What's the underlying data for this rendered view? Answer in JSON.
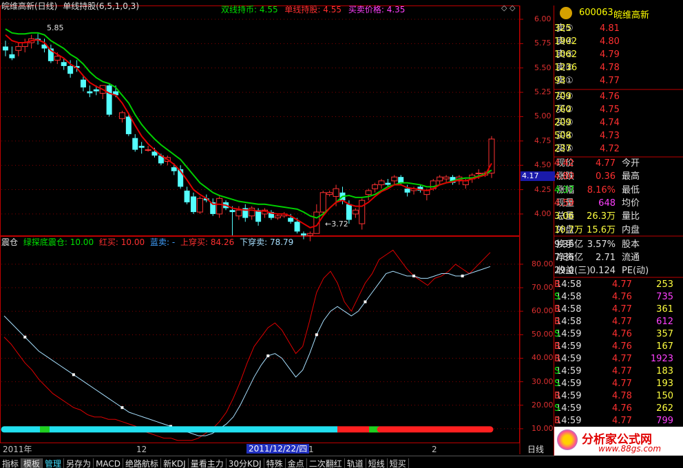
{
  "header": {
    "title": "皖维高新(日线)",
    "formula": "单线持股(6,5,1,0,3)",
    "double_hold_label": "双线持币:",
    "double_hold_value": "4.55",
    "single_hold_label": "单线持股:",
    "single_hold_value": "4.55",
    "trade_price_label": "买卖价格:",
    "trade_price_value": "4.35",
    "max_label": "5.85",
    "min_label": "3.72",
    "current_price_tag": "4.17"
  },
  "lower_header": {
    "name": "震仓",
    "green_bottom_label": "绿探底震仓:",
    "green_bottom_value": "10.00",
    "red_buy_label": "红买:",
    "red_buy_value": "10.00",
    "blue_sell_label": "蓝卖:",
    "blue_sell_value": "-",
    "upcross_label": "上穿买:",
    "upcross_value": "84.26",
    "downcross_label": "下穿卖:",
    "downcross_value": "78.79"
  },
  "upper_axis": [
    "6.00",
    "5.75",
    "5.50",
    "5.25",
    "5.00",
    "4.75",
    "4.50",
    "4.25",
    "4.00"
  ],
  "lower_axis": [
    "80.00",
    "70.00",
    "60.00",
    "50.00",
    "40.00",
    "30.00",
    "20.00",
    "10.00"
  ],
  "date_axis": {
    "year": "2011年",
    "m12": "12",
    "cursor_date": "2011/12/22/四",
    "m1": "1",
    "m2": "2",
    "period": "日线"
  },
  "stock": {
    "code": "600063",
    "name": "皖维高新"
  },
  "order_book": {
    "asks": [
      {
        "label": "卖⑤",
        "price": "4.81",
        "vol": "325"
      },
      {
        "label": "卖④",
        "price": "4.80",
        "vol": "1902"
      },
      {
        "label": "卖③",
        "price": "4.79",
        "vol": "1062"
      },
      {
        "label": "卖②",
        "price": "4.78",
        "vol": "1236"
      },
      {
        "label": "卖①",
        "price": "4.77",
        "vol": "93"
      }
    ],
    "bids": [
      {
        "label": "买①",
        "price": "4.76",
        "vol": "709"
      },
      {
        "label": "买②",
        "price": "4.75",
        "vol": "760"
      },
      {
        "label": "买③",
        "price": "4.74",
        "vol": "209"
      },
      {
        "label": "买④",
        "price": "4.73",
        "vol": "508"
      },
      {
        "label": "买⑤",
        "price": "4.72",
        "vol": "237"
      }
    ]
  },
  "quote": [
    {
      "l1": "现价",
      "v1": "4.77",
      "l2": "今开",
      "v2": "4.42"
    },
    {
      "l1": "涨跌",
      "v1": "0.36",
      "l2": "最高",
      "v2": "4.80"
    },
    {
      "l1": "涨幅",
      "v1": "8.16%",
      "l2": "最低",
      "v2": "4.37"
    },
    {
      "l1": "现量",
      "v1": "648",
      "l2": "均价",
      "v2": "4.59"
    },
    {
      "l1": "总量",
      "v1": "26.3万",
      "l2": "量比",
      "v2": "3.06"
    },
    {
      "l1": "外盘",
      "v1": "15.6万",
      "l2": "内盘",
      "v2": "10.7万"
    },
    {
      "l1": "换手",
      "v1": "3.57%",
      "l2": "股本",
      "v2": "9.36亿"
    },
    {
      "l1": "净资",
      "v1": "2.71",
      "l2": "流通",
      "v2": "7.36亿"
    },
    {
      "l1": "收益(三)",
      "v1": "0.124",
      "l2": "PE(动)",
      "v2": "29.0"
    }
  ],
  "ticks": [
    {
      "t": "14:58",
      "p": "4.77",
      "v": "253",
      "s": "B"
    },
    {
      "t": "14:58",
      "p": "4.76",
      "v": "735",
      "s": "S"
    },
    {
      "t": "14:58",
      "p": "4.77",
      "v": "361",
      "s": "B"
    },
    {
      "t": "14:58",
      "p": "4.77",
      "v": "612",
      "s": "B"
    },
    {
      "t": "14:59",
      "p": "4.76",
      "v": "357",
      "s": "S"
    },
    {
      "t": "14:59",
      "p": "4.76",
      "v": "167",
      "s": "B"
    },
    {
      "t": "14:59",
      "p": "4.77",
      "v": "1923",
      "s": "B"
    },
    {
      "t": "14:59",
      "p": "4.77",
      "v": "183",
      "s": "S"
    },
    {
      "t": "14:59",
      "p": "4.77",
      "v": "193",
      "s": "S"
    },
    {
      "t": "14:59",
      "p": "4.78",
      "v": "150",
      "s": "B"
    },
    {
      "t": "14:59",
      "p": "4.76",
      "v": "262",
      "s": "S"
    },
    {
      "t": "14:59",
      "p": "4.77",
      "v": "799",
      "s": "B"
    }
  ],
  "watermark": {
    "brand": "分析家公式网",
    "url": "www.88gs.com"
  },
  "bottom_tabs": [
    "指标",
    "模板",
    "管理",
    "另存为",
    "MACD",
    "绝路航标",
    "新KDJ",
    "量看主力",
    "30分KDJ",
    "特殊",
    "金点",
    "二次翻红",
    "轨道",
    "短线",
    "短买"
  ],
  "colors": {
    "up": "#ff3232",
    "down": "#54ffff",
    "green_line": "#00d000",
    "red_line": "#e00000",
    "white_line": "#a8e0ff",
    "axis": "#c00000"
  },
  "chart_data": [
    {
      "type": "candlestick",
      "title": "皖维高新(日线)",
      "ylim": [
        3.62,
        6.02
      ],
      "candles": [
        [
          5.72,
          5.78,
          5.62,
          5.68
        ],
        [
          5.64,
          5.72,
          5.58,
          5.6
        ],
        [
          5.68,
          5.76,
          5.62,
          5.72
        ],
        [
          5.72,
          5.8,
          5.66,
          5.76
        ],
        [
          5.76,
          5.84,
          5.7,
          5.8
        ],
        [
          5.8,
          5.85,
          5.74,
          5.78
        ],
        [
          5.74,
          5.8,
          5.66,
          5.7
        ],
        [
          5.7,
          5.74,
          5.55,
          5.57
        ],
        [
          5.58,
          5.66,
          5.54,
          5.62
        ],
        [
          5.56,
          5.6,
          5.48,
          5.52
        ],
        [
          5.52,
          5.58,
          5.4,
          5.44
        ],
        [
          5.52,
          5.58,
          5.46,
          5.5
        ],
        [
          5.38,
          5.42,
          5.26,
          5.3
        ],
        [
          5.26,
          5.32,
          5.2,
          5.24
        ],
        [
          5.28,
          5.32,
          5.22,
          5.26
        ],
        [
          5.24,
          5.32,
          5.18,
          5.32
        ],
        [
          5.32,
          5.34,
          5.0,
          5.02
        ],
        [
          5.26,
          5.32,
          5.2,
          5.22
        ],
        [
          4.98,
          5.06,
          4.94,
          5.04
        ],
        [
          5.0,
          5.04,
          4.8,
          4.82
        ],
        [
          4.78,
          4.82,
          4.64,
          4.66
        ],
        [
          4.7,
          4.74,
          4.62,
          4.68
        ],
        [
          4.66,
          4.7,
          4.64,
          4.66
        ],
        [
          4.64,
          4.68,
          4.58,
          4.6
        ],
        [
          4.6,
          4.62,
          4.5,
          4.52
        ],
        [
          4.54,
          4.6,
          4.5,
          4.58
        ],
        [
          4.48,
          4.52,
          4.4,
          4.44
        ],
        [
          4.46,
          4.5,
          4.26,
          4.28
        ],
        [
          4.24,
          4.28,
          4.1,
          4.12
        ],
        [
          4.18,
          4.22,
          4.0,
          4.02
        ],
        [
          4.02,
          4.18,
          4.0,
          4.16
        ],
        [
          4.16,
          4.2,
          4.12,
          4.14
        ],
        [
          4.12,
          4.16,
          3.98,
          4.0
        ],
        [
          4.0,
          4.18,
          3.96,
          4.16
        ],
        [
          4.12,
          4.14,
          4.04,
          4.06
        ],
        [
          4.04,
          4.08,
          3.78,
          4.02
        ],
        [
          3.98,
          4.08,
          3.94,
          4.04
        ],
        [
          4.06,
          4.1,
          3.92,
          3.96
        ],
        [
          3.98,
          4.08,
          3.94,
          4.06
        ],
        [
          4.04,
          4.06,
          3.88,
          3.92
        ],
        [
          4.0,
          4.06,
          3.96,
          4.04
        ],
        [
          4.02,
          4.04,
          3.94,
          3.96
        ],
        [
          3.96,
          4.0,
          3.94,
          3.98
        ],
        [
          3.98,
          4.02,
          3.96,
          4.0
        ],
        [
          3.96,
          4.0,
          3.9,
          3.92
        ],
        [
          3.92,
          3.96,
          3.8,
          3.82
        ],
        [
          3.8,
          3.82,
          3.74,
          3.78
        ],
        [
          3.78,
          3.82,
          3.72,
          3.8
        ],
        [
          3.8,
          4.1,
          3.8,
          4.02
        ],
        [
          4.02,
          4.24,
          4.0,
          4.22
        ],
        [
          4.2,
          4.24,
          4.18,
          4.22
        ],
        [
          4.18,
          4.3,
          4.08,
          4.26
        ],
        [
          4.22,
          4.28,
          4.1,
          4.14
        ],
        [
          4.1,
          4.14,
          3.9,
          3.94
        ],
        [
          4.0,
          4.06,
          3.96,
          4.04
        ],
        [
          3.9,
          4.16,
          3.84,
          4.14
        ],
        [
          4.2,
          4.26,
          4.14,
          4.24
        ],
        [
          4.26,
          4.32,
          4.22,
          4.3
        ],
        [
          4.3,
          4.36,
          4.26,
          4.34
        ],
        [
          4.32,
          4.36,
          4.28,
          4.3
        ],
        [
          4.34,
          4.4,
          4.3,
          4.38
        ],
        [
          4.38,
          4.4,
          4.3,
          4.32
        ],
        [
          4.26,
          4.3,
          4.18,
          4.22
        ],
        [
          4.24,
          4.28,
          4.2,
          4.26
        ],
        [
          4.28,
          4.3,
          4.22,
          4.24
        ],
        [
          4.2,
          4.26,
          4.14,
          4.24
        ],
        [
          4.26,
          4.36,
          4.24,
          4.34
        ],
        [
          4.34,
          4.4,
          4.3,
          4.38
        ],
        [
          4.36,
          4.4,
          4.32,
          4.38
        ],
        [
          4.38,
          4.4,
          4.3,
          4.32
        ],
        [
          4.34,
          4.4,
          4.3,
          4.38
        ],
        [
          4.3,
          4.36,
          4.26,
          4.34
        ],
        [
          4.36,
          4.42,
          4.32,
          4.4
        ],
        [
          4.42,
          4.46,
          4.36,
          4.42
        ],
        [
          4.4,
          4.44,
          4.38,
          4.42
        ],
        [
          4.42,
          4.8,
          4.37,
          4.77
        ]
      ],
      "series": [
        {
          "name": "双线持币",
          "values": [
            5.9,
            5.86,
            5.85,
            5.85,
            5.86,
            5.86,
            5.84,
            5.78,
            5.74,
            5.7,
            5.64,
            5.6,
            5.54,
            5.46,
            5.4,
            5.36,
            5.34,
            5.3,
            5.22,
            5.14,
            5.02,
            4.92,
            4.84,
            4.77,
            4.71,
            4.66,
            4.61,
            4.56,
            4.48,
            4.4,
            4.32,
            4.27,
            4.22,
            4.19,
            4.17,
            4.15,
            4.13,
            4.12,
            4.11,
            4.1,
            4.1,
            4.09,
            4.08,
            4.07,
            4.06,
            4.05,
            4.02,
            3.98,
            3.96,
            4.0,
            4.06,
            4.12,
            4.18,
            4.19,
            4.17,
            4.17,
            4.18,
            4.2,
            4.24,
            4.28,
            4.3,
            4.32,
            4.32,
            4.31,
            4.3,
            4.28,
            4.28,
            4.3,
            4.32,
            4.34,
            4.36,
            4.37,
            4.37,
            4.39,
            4.41,
            4.45
          ]
        },
        {
          "name": "单线持股",
          "values": [
            5.84,
            5.78,
            5.76,
            5.76,
            5.78,
            5.79,
            5.76,
            5.68,
            5.64,
            5.6,
            5.54,
            5.5,
            5.42,
            5.35,
            5.31,
            5.28,
            5.24,
            5.22,
            5.14,
            5.03,
            4.91,
            4.8,
            4.72,
            4.66,
            4.6,
            4.56,
            4.51,
            4.44,
            4.35,
            4.25,
            4.2,
            4.16,
            4.1,
            4.1,
            4.09,
            4.06,
            4.05,
            4.04,
            4.04,
            4.03,
            4.03,
            4.01,
            4.0,
            4.0,
            3.98,
            3.94,
            3.9,
            3.86,
            3.88,
            3.98,
            4.06,
            4.12,
            4.14,
            4.1,
            4.08,
            4.08,
            4.12,
            4.18,
            4.23,
            4.26,
            4.3,
            4.3,
            4.27,
            4.26,
            4.25,
            4.24,
            4.26,
            4.3,
            4.32,
            4.33,
            4.35,
            4.34,
            4.36,
            4.38,
            4.4,
            4.52
          ]
        }
      ]
    },
    {
      "type": "line",
      "title": "震仓",
      "ylim": [
        5,
        87
      ],
      "series": [
        {
          "name": "上穿买",
          "values": [
            49,
            46,
            42,
            38,
            35,
            31,
            28,
            25,
            23,
            21,
            19,
            18,
            16,
            15,
            15,
            14,
            14,
            13,
            12,
            11,
            9,
            8,
            7,
            6,
            6,
            5,
            5,
            5,
            6,
            8,
            10,
            13,
            17,
            23,
            30,
            38,
            45,
            49,
            53,
            55,
            52,
            47,
            42,
            45,
            56,
            68,
            74,
            77,
            72,
            64,
            60,
            66,
            72,
            76,
            82,
            84,
            86,
            82,
            78,
            75,
            73,
            71,
            74,
            75,
            77,
            80,
            78,
            76,
            79,
            82,
            85
          ]
        },
        {
          "name": "下穿卖",
          "values": [
            58,
            55,
            52,
            49,
            46,
            43,
            41,
            39,
            37,
            35,
            33,
            31,
            29,
            27,
            25,
            23,
            21,
            19,
            17,
            16,
            15,
            14,
            13,
            12,
            11,
            10,
            9,
            8,
            7,
            7,
            8,
            10,
            12,
            15,
            20,
            26,
            32,
            37,
            41,
            42,
            40,
            36,
            32,
            35,
            42,
            50,
            56,
            60,
            62,
            60,
            58,
            60,
            64,
            68,
            72,
            76,
            77,
            76,
            75,
            75,
            74,
            74,
            75,
            76,
            76,
            75,
            75,
            76,
            77,
            78,
            79
          ]
        }
      ]
    }
  ]
}
